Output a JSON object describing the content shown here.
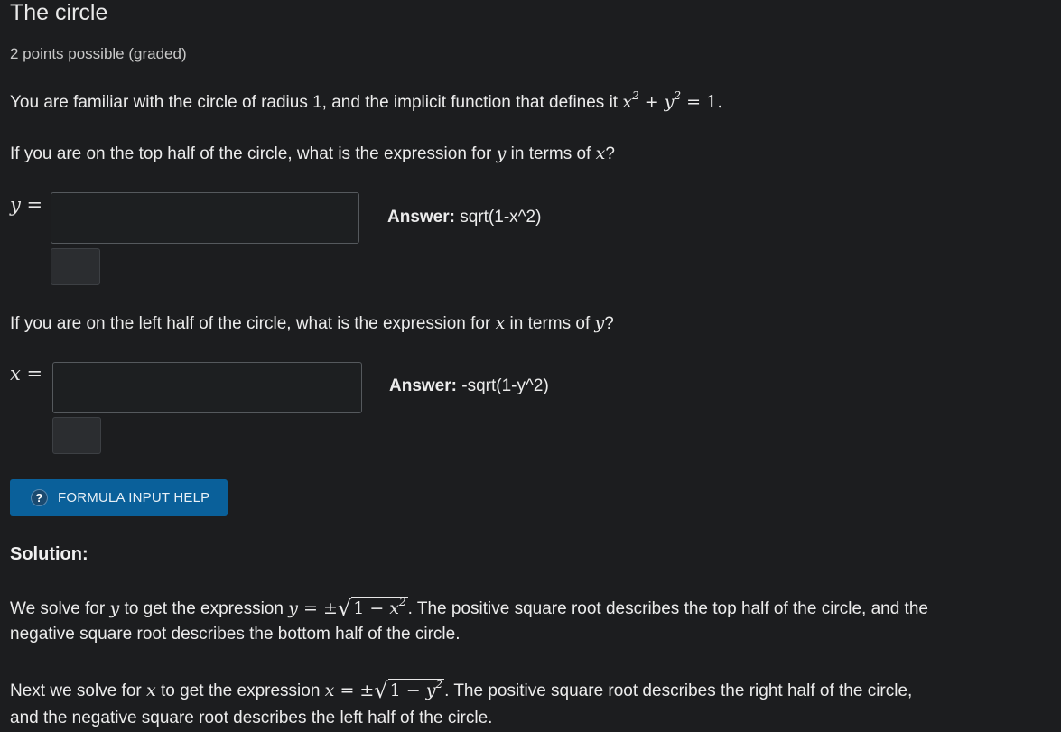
{
  "problem": {
    "title": "The circle",
    "points": "2 points possible (graded)",
    "intro_text": "You are familiar with the circle of radius 1, and the implicit function that defines it ",
    "q1_prefix": "If you are on the top half of the circle, what is the expression for ",
    "q1_mid": " in terms of ",
    "q1_suffix": "?",
    "q2_prefix": "If you are on the left half of the circle, what is the expression for ",
    "q2_mid": " in terms of ",
    "q2_suffix": "?"
  },
  "inputs": [
    {
      "label_var": "y",
      "value": "",
      "placeholder": "",
      "answer_label": "Answer:",
      "answer_value": "sqrt(1-x^2)"
    },
    {
      "label_var": "x",
      "value": "",
      "placeholder": "",
      "answer_label": "Answer:",
      "answer_value": "-sqrt(1-y^2)"
    }
  ],
  "help_button": {
    "icon": "question-icon",
    "icon_glyph": "?",
    "label": "FORMULA INPUT HELP"
  },
  "solution": {
    "heading": "Solution:",
    "p1_prefix": "We solve for ",
    "p1_mid": " to get the expression ",
    "p1_suffix": ". The positive square root describes the top half of the circle, and the",
    "p1_line2": "negative square root describes the bottom half of the circle.",
    "p2_prefix": "Next we solve for ",
    "p2_mid": " to get the expression ",
    "p2_suffix": ". The positive square root describes the right half of the circle,",
    "p2_line2": "and the negative square root describes the left half of the circle."
  },
  "colors": {
    "background": "#1c1d1f",
    "button": "#0a609a",
    "text": "#ececec"
  }
}
